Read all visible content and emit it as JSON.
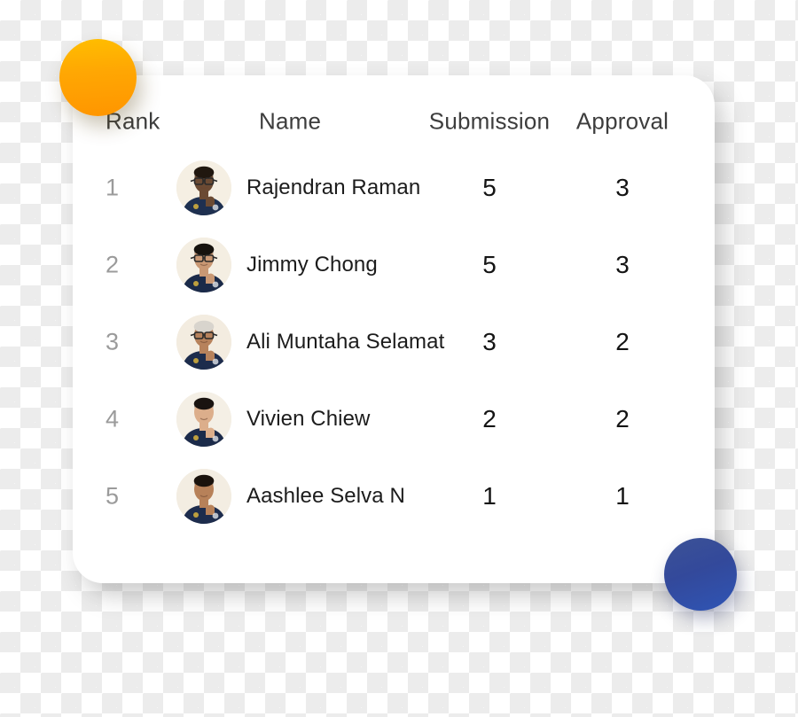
{
  "card": {
    "columns": {
      "rank": "Rank",
      "name": "Name",
      "submission": "Submission",
      "approval": "Approval"
    },
    "rows": [
      {
        "rank": "1",
        "name": "Rajendran Raman",
        "submission": "5",
        "approval": "3",
        "avatar": "avatar-rajendran-raman",
        "skin": "#6b4a33",
        "hair": "#20170f",
        "shirt": "#1e3050",
        "bg": "#f5efe3",
        "glasses": true
      },
      {
        "rank": "2",
        "name": "Jimmy Chong",
        "submission": "5",
        "approval": "3",
        "avatar": "avatar-jimmy-chong",
        "skin": "#c99874",
        "hair": "#16120d",
        "shirt": "#1b2a49",
        "bg": "#f4eee2",
        "glasses": true
      },
      {
        "rank": "3",
        "name": "Ali Muntaha Selamat",
        "submission": "3",
        "approval": "2",
        "avatar": "avatar-ali-muntaha-selamat",
        "skin": "#b7825c",
        "hair": "#d8d4cd",
        "shirt": "#1d2c4c",
        "bg": "#f3ece0",
        "glasses": true
      },
      {
        "rank": "4",
        "name": "Vivien Chiew",
        "submission": "2",
        "approval": "2",
        "avatar": "avatar-vivien-chiew",
        "skin": "#dcae8b",
        "hair": "#191310",
        "shirt": "#1c2b4a",
        "bg": "#f4efe5",
        "glasses": false
      },
      {
        "rank": "5",
        "name": "Aashlee Selva N",
        "submission": "1",
        "approval": "1",
        "avatar": "avatar-aashlee-selva-n",
        "skin": "#b78159",
        "hair": "#1a120c",
        "shirt": "#1d2c4d",
        "bg": "#f3ede2",
        "glasses": false
      }
    ]
  },
  "decor": {
    "orange_circle": "#ffa703",
    "blue_circle": "#33499b"
  }
}
